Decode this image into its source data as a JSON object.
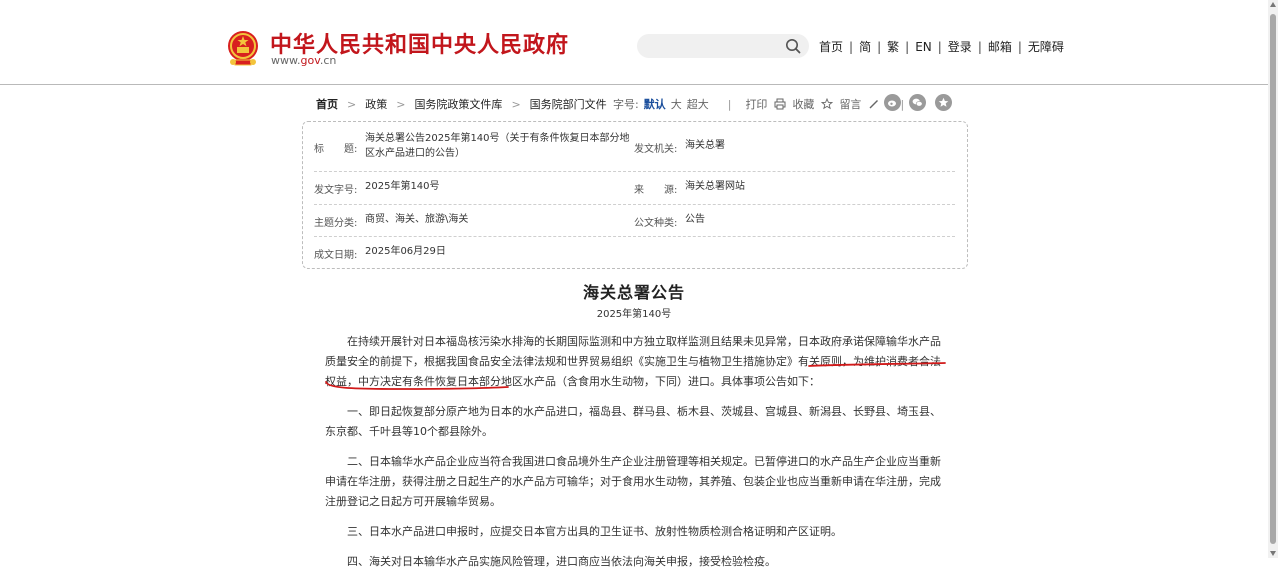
{
  "header": {
    "site_title": "中华人民共和国中央人民政府",
    "site_url_prefix": "www.",
    "site_url_gov": "gov",
    "site_url_suffix": ".cn",
    "search_placeholder": "",
    "nav": [
      "首页",
      "简",
      "繁",
      "EN",
      "登录",
      "邮箱",
      "无障碍"
    ],
    "nav_separator": "|",
    "brand_color": "#c2161c"
  },
  "breadcrumb": {
    "items": [
      "首页",
      "政策",
      "国务院政策文件库",
      "国务院部门文件"
    ],
    "chevron": ">"
  },
  "tools": {
    "font_label": "字号:",
    "font_default": "默认",
    "font_large": "大",
    "font_xlarge": "超大",
    "separator": "|",
    "print": "打印",
    "collect": "收藏",
    "comment": "留言",
    "share_icons": [
      "weibo-icon",
      "wechat-icon",
      "star-icon"
    ]
  },
  "info": {
    "title_label": "标　　题:",
    "title_value": "海关总署公告2025年第140号（关于有条件恢复日本部分地区水产品进口的公告）",
    "issuer_label": "发文机关:",
    "issuer_value": "海关总署",
    "number_label": "发文字号:",
    "number_value": "2025年第140号",
    "source_label": "来　　源:",
    "source_value": "海关总署网站",
    "topic_label": "主题分类:",
    "topic_value": "商贸、海关、旅游\\海关",
    "type_label": "公文种类:",
    "type_value": "公告",
    "date_label": "成文日期:",
    "date_value": "2025年06月29日"
  },
  "article": {
    "title": "海关总署公告",
    "subtitle": "2025年第140号",
    "p1_a": "在持续开展针对日本福岛核污染水排海的长期国际监测和中方独立取样监测且结果未见异常，日本政府承诺保障输华水产品质量安全的前提下，根据我国食品安全法律法规和世界贸易组织《实施卫生与植物卫生措施协定》有关原则，",
    "p1_hl": "为维护消费者合法权益，中方决定有条件恢复日本部分地区水产品",
    "p1_b": "（含食用水生动物，下同）进口。具体事项公告如下：",
    "p2": "一、即日起恢复部分原产地为日本的水产品进口，福岛县、群马县、栃木县、茨城县、宫城县、新潟县、长野县、埼玉县、东京都、千叶县等10个都县除外。",
    "p3": "二、日本输华水产品企业应当符合我国进口食品境外生产企业注册管理等相关规定。已暂停进口的水产品生产企业应当重新申请在华注册，获得注册之日起生产的水产品方可输华；对于食用水生动物，其养殖、包装企业也应当重新申请在华注册，完成注册登记之日起方可开展输华贸易。",
    "p4": "三、日本水产品进口申报时，应提交日本官方出具的卫生证书、放射性物质检测合格证明和产区证明。",
    "p5": "四、海关对日本输华水产品实施风险管理，进口商应当依法向海关申报，接受检验检疫。",
    "annotation_color": "#d11a1a"
  }
}
